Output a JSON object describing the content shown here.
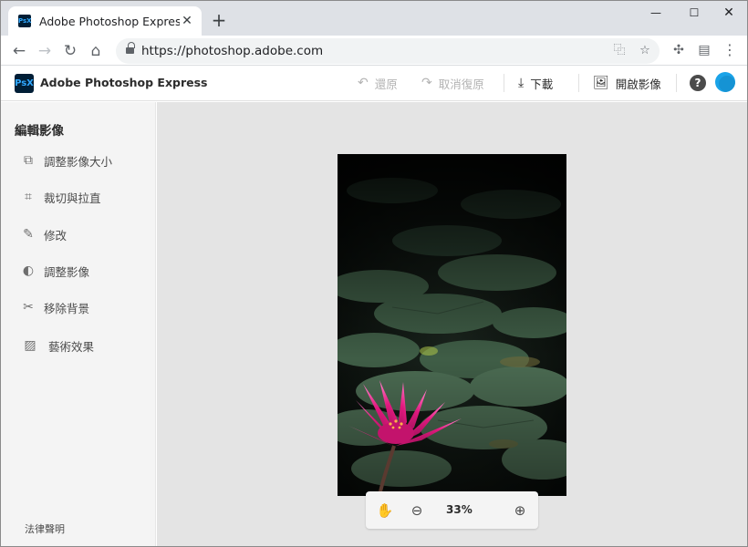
{
  "browser": {
    "tab_title": "Adobe Photoshop Express",
    "favicon_text": "PsX",
    "url": "https://photoshop.adobe.com",
    "window_controls": [
      "minimize-icon",
      "maximize-icon",
      "close-icon"
    ]
  },
  "app": {
    "logo_text": "PsX",
    "name": "Adobe Photoshop Express",
    "actions": {
      "undo": "還原",
      "redo": "取消復原",
      "download": "下載",
      "open_image": "開啟影像"
    },
    "accent_color": "#1aa3e8"
  },
  "sidebar": {
    "title": "編輯影像",
    "items": [
      {
        "label": "調整影像大小",
        "icon": "resize-icon"
      },
      {
        "label": "裁切與拉直",
        "icon": "crop-icon"
      },
      {
        "label": "修改",
        "icon": "bandage-icon"
      },
      {
        "label": "調整影像",
        "icon": "adjust-icon"
      },
      {
        "label": "移除背景",
        "icon": "scissors-icon"
      },
      {
        "label": "藝術效果",
        "icon": "image-effects-icon"
      }
    ],
    "legal": "法律聲明"
  },
  "canvas": {
    "zoom": "33%",
    "image_subject": "pink water lily among lily pads"
  }
}
